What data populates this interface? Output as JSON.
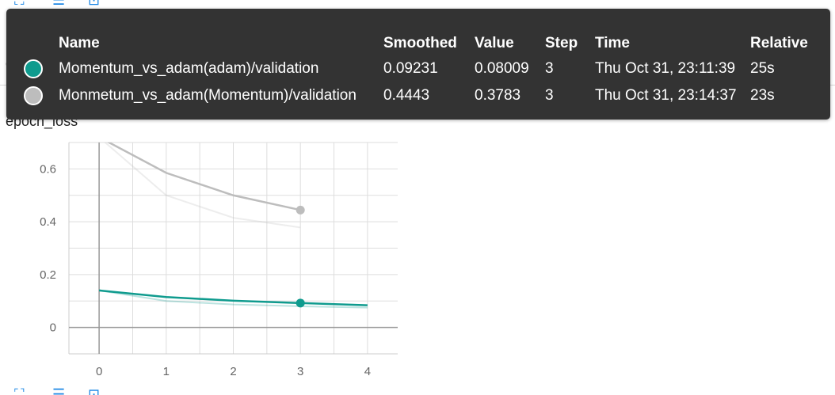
{
  "card": {
    "title": "epoch_loss"
  },
  "tooltip": {
    "headers": {
      "name": "Name",
      "smoothed": "Smoothed",
      "value": "Value",
      "step": "Step",
      "time": "Time",
      "relative": "Relative"
    },
    "rows": [
      {
        "color": "#0f9b8e",
        "name": "Momentum_vs_adam(adam)/validation",
        "smoothed": "0.09231",
        "value": "0.08009",
        "step": "3",
        "time": "Thu Oct 31, 23:11:39",
        "relative": "25s"
      },
      {
        "color": "#bdbdbd",
        "name": "Monmetum_vs_adam(Momentum)/validation",
        "smoothed": "0.4443",
        "value": "0.3783",
        "step": "3",
        "time": "Thu Oct 31, 23:14:37",
        "relative": "23s"
      }
    ]
  },
  "toolbar_icons": [
    "fit-domain-icon",
    "menu-icon",
    "expand-icon"
  ],
  "chart_data": {
    "type": "line",
    "title": "epoch_loss",
    "xlabel": "",
    "ylabel": "",
    "xlim": [
      -0.45,
      4.45
    ],
    "ylim": [
      -0.1,
      0.7
    ],
    "x_ticks": [
      "0",
      "1",
      "2",
      "3",
      "4"
    ],
    "y_ticks": [
      "0",
      "0.2",
      "0.4",
      "0.6"
    ],
    "grid": true,
    "series": [
      {
        "name": "Momentum_vs_adam(adam)/validation",
        "color": "#0f9b8e",
        "x": [
          0,
          1,
          2,
          3,
          4
        ],
        "smoothed": [
          0.14,
          0.115,
          0.101,
          0.0923,
          0.084
        ],
        "raw": [
          0.14,
          0.1,
          0.087,
          0.08,
          0.075
        ],
        "highlight_step": 3,
        "highlight_value": 0.0923
      },
      {
        "name": "Monmetum_vs_adam(Momentum)/validation",
        "color": "#bdbdbd",
        "x": [
          0,
          1,
          2,
          3
        ],
        "smoothed": [
          0.72,
          0.585,
          0.5,
          0.4443
        ],
        "raw": [
          0.72,
          0.5,
          0.415,
          0.3783
        ],
        "highlight_step": 3,
        "highlight_value": 0.4443
      }
    ]
  }
}
